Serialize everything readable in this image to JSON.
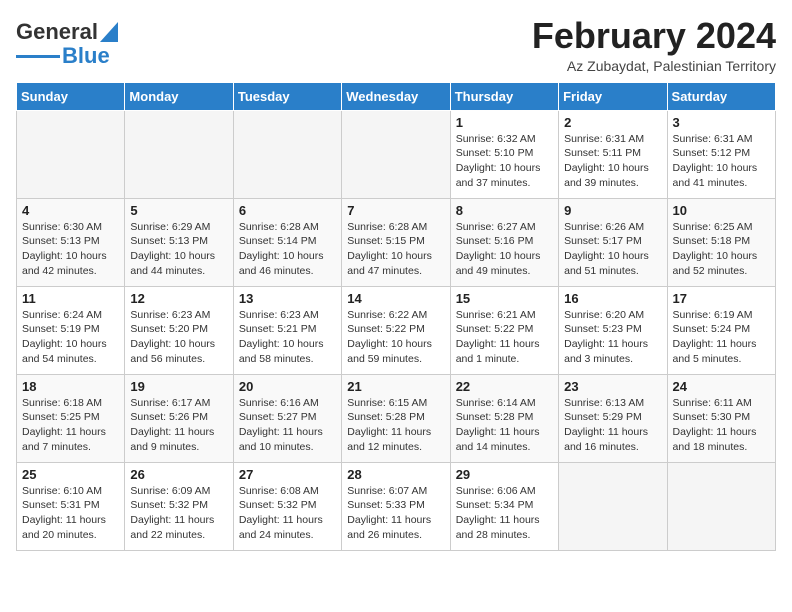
{
  "logo": {
    "line1": "General",
    "line2": "Blue"
  },
  "title": "February 2024",
  "subtitle": "Az Zubaydat, Palestinian Territory",
  "weekdays": [
    "Sunday",
    "Monday",
    "Tuesday",
    "Wednesday",
    "Thursday",
    "Friday",
    "Saturday"
  ],
  "weeks": [
    [
      {
        "day": "",
        "info": ""
      },
      {
        "day": "",
        "info": ""
      },
      {
        "day": "",
        "info": ""
      },
      {
        "day": "",
        "info": ""
      },
      {
        "day": "1",
        "info": "Sunrise: 6:32 AM\nSunset: 5:10 PM\nDaylight: 10 hours\nand 37 minutes."
      },
      {
        "day": "2",
        "info": "Sunrise: 6:31 AM\nSunset: 5:11 PM\nDaylight: 10 hours\nand 39 minutes."
      },
      {
        "day": "3",
        "info": "Sunrise: 6:31 AM\nSunset: 5:12 PM\nDaylight: 10 hours\nand 41 minutes."
      }
    ],
    [
      {
        "day": "4",
        "info": "Sunrise: 6:30 AM\nSunset: 5:13 PM\nDaylight: 10 hours\nand 42 minutes."
      },
      {
        "day": "5",
        "info": "Sunrise: 6:29 AM\nSunset: 5:13 PM\nDaylight: 10 hours\nand 44 minutes."
      },
      {
        "day": "6",
        "info": "Sunrise: 6:28 AM\nSunset: 5:14 PM\nDaylight: 10 hours\nand 46 minutes."
      },
      {
        "day": "7",
        "info": "Sunrise: 6:28 AM\nSunset: 5:15 PM\nDaylight: 10 hours\nand 47 minutes."
      },
      {
        "day": "8",
        "info": "Sunrise: 6:27 AM\nSunset: 5:16 PM\nDaylight: 10 hours\nand 49 minutes."
      },
      {
        "day": "9",
        "info": "Sunrise: 6:26 AM\nSunset: 5:17 PM\nDaylight: 10 hours\nand 51 minutes."
      },
      {
        "day": "10",
        "info": "Sunrise: 6:25 AM\nSunset: 5:18 PM\nDaylight: 10 hours\nand 52 minutes."
      }
    ],
    [
      {
        "day": "11",
        "info": "Sunrise: 6:24 AM\nSunset: 5:19 PM\nDaylight: 10 hours\nand 54 minutes."
      },
      {
        "day": "12",
        "info": "Sunrise: 6:23 AM\nSunset: 5:20 PM\nDaylight: 10 hours\nand 56 minutes."
      },
      {
        "day": "13",
        "info": "Sunrise: 6:23 AM\nSunset: 5:21 PM\nDaylight: 10 hours\nand 58 minutes."
      },
      {
        "day": "14",
        "info": "Sunrise: 6:22 AM\nSunset: 5:22 PM\nDaylight: 10 hours\nand 59 minutes."
      },
      {
        "day": "15",
        "info": "Sunrise: 6:21 AM\nSunset: 5:22 PM\nDaylight: 11 hours\nand 1 minute."
      },
      {
        "day": "16",
        "info": "Sunrise: 6:20 AM\nSunset: 5:23 PM\nDaylight: 11 hours\nand 3 minutes."
      },
      {
        "day": "17",
        "info": "Sunrise: 6:19 AM\nSunset: 5:24 PM\nDaylight: 11 hours\nand 5 minutes."
      }
    ],
    [
      {
        "day": "18",
        "info": "Sunrise: 6:18 AM\nSunset: 5:25 PM\nDaylight: 11 hours\nand 7 minutes."
      },
      {
        "day": "19",
        "info": "Sunrise: 6:17 AM\nSunset: 5:26 PM\nDaylight: 11 hours\nand 9 minutes."
      },
      {
        "day": "20",
        "info": "Sunrise: 6:16 AM\nSunset: 5:27 PM\nDaylight: 11 hours\nand 10 minutes."
      },
      {
        "day": "21",
        "info": "Sunrise: 6:15 AM\nSunset: 5:28 PM\nDaylight: 11 hours\nand 12 minutes."
      },
      {
        "day": "22",
        "info": "Sunrise: 6:14 AM\nSunset: 5:28 PM\nDaylight: 11 hours\nand 14 minutes."
      },
      {
        "day": "23",
        "info": "Sunrise: 6:13 AM\nSunset: 5:29 PM\nDaylight: 11 hours\nand 16 minutes."
      },
      {
        "day": "24",
        "info": "Sunrise: 6:11 AM\nSunset: 5:30 PM\nDaylight: 11 hours\nand 18 minutes."
      }
    ],
    [
      {
        "day": "25",
        "info": "Sunrise: 6:10 AM\nSunset: 5:31 PM\nDaylight: 11 hours\nand 20 minutes."
      },
      {
        "day": "26",
        "info": "Sunrise: 6:09 AM\nSunset: 5:32 PM\nDaylight: 11 hours\nand 22 minutes."
      },
      {
        "day": "27",
        "info": "Sunrise: 6:08 AM\nSunset: 5:32 PM\nDaylight: 11 hours\nand 24 minutes."
      },
      {
        "day": "28",
        "info": "Sunrise: 6:07 AM\nSunset: 5:33 PM\nDaylight: 11 hours\nand 26 minutes."
      },
      {
        "day": "29",
        "info": "Sunrise: 6:06 AM\nSunset: 5:34 PM\nDaylight: 11 hours\nand 28 minutes."
      },
      {
        "day": "",
        "info": ""
      },
      {
        "day": "",
        "info": ""
      }
    ]
  ]
}
